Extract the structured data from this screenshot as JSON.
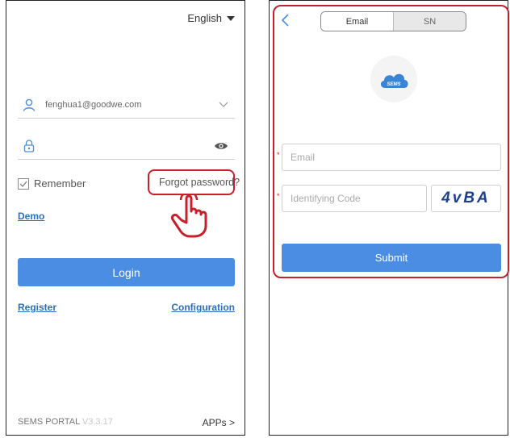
{
  "login": {
    "language": "English",
    "account_value": "fenghua1@goodwe.com",
    "remember_label": "Remember",
    "forgot_label": "Forgot password?",
    "demo_label": "Demo",
    "login_label": "Login",
    "register_label": "Register",
    "configuration_label": "Configuration",
    "footer_brand": "SEMS PORTAL",
    "footer_version": "V3.3.17",
    "apps_label": "APPs >"
  },
  "forgot": {
    "tabs": [
      {
        "label": "Email",
        "active": true
      },
      {
        "label": "SN",
        "active": false
      }
    ],
    "logo_text": "SEMS",
    "email_placeholder": "Email",
    "code_placeholder": "Identifying Code",
    "captcha_text": "4vBA",
    "required_mark": "*",
    "submit_label": "Submit"
  },
  "colors": {
    "accent": "#4a8de2",
    "link": "#2a6fbf",
    "highlight": "#c8202a"
  },
  "icons": [
    "user-icon",
    "lock-icon",
    "chevron-down-icon",
    "eye-icon",
    "check-icon",
    "caret-down-icon",
    "back-arrow-icon",
    "cloud-icon",
    "pointing-hand-icon"
  ]
}
